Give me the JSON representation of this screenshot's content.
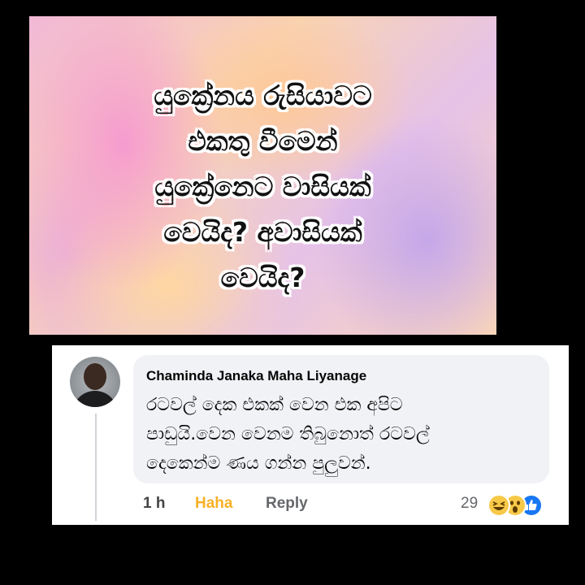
{
  "post_image": {
    "headline_lines": [
      "යුක්‍රේනය රුසියාවට",
      "එකතු වීමෙන්",
      "යුක්‍රේනෙට වාසියක්",
      "වෙයිද? අවාසියක්",
      "වෙයිද?"
    ]
  },
  "comment": {
    "author": "Chaminda Janaka Maha Liyanage",
    "text_lines": [
      "රටවල් දෙක එකක් වෙන එක අපිට",
      "පාඩුයි.වෙන වෙනම තිබුනොත් රටවල්",
      "දෙකෙන්ම ණය ගන්න පුලුවන්."
    ],
    "time": "1 h",
    "reaction_label": "Haha",
    "reply_label": "Reply",
    "reaction_count": "29",
    "reaction_icons": [
      "haha-emoji-icon",
      "wow-emoji-icon",
      "like-thumb-icon"
    ]
  },
  "colors": {
    "haha_accent": "#f7b125",
    "like_blue": "#1877f2",
    "bubble_bg": "#f0f2f5"
  }
}
